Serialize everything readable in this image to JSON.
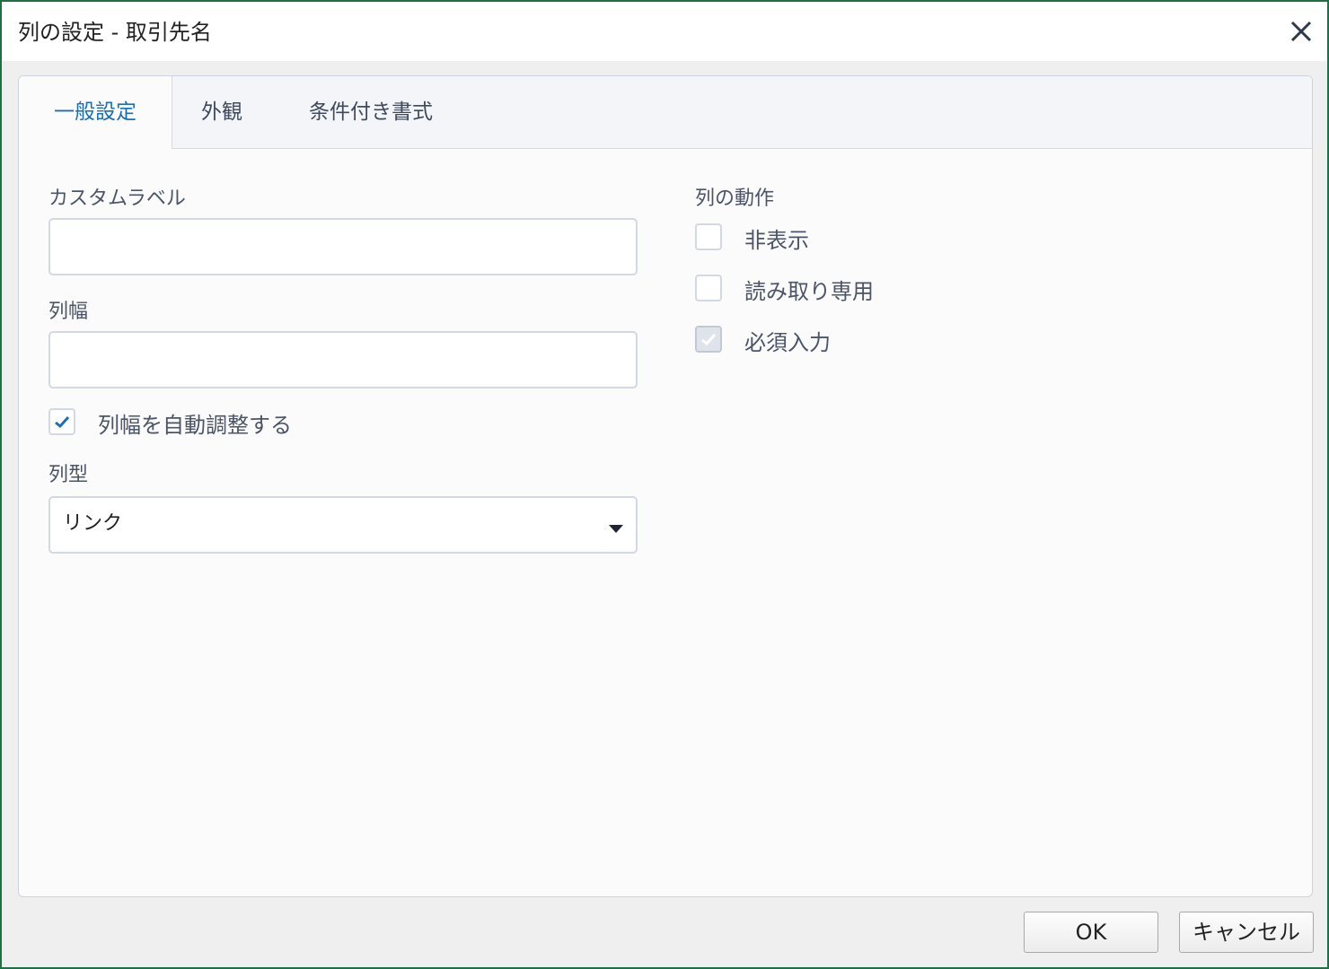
{
  "window": {
    "title": "列の設定 - 取引先名"
  },
  "tabs": [
    {
      "label": "一般設定",
      "active": true
    },
    {
      "label": "外観",
      "active": false
    },
    {
      "label": "条件付き書式",
      "active": false
    }
  ],
  "general": {
    "custom_label": {
      "label": "カスタムラベル",
      "value": "",
      "placeholder": ""
    },
    "column_width": {
      "label": "列幅",
      "value": "",
      "placeholder": ""
    },
    "autofit": {
      "label": "列幅を自動調整する",
      "checked": true
    },
    "column_type": {
      "label": "列型",
      "selected": "リンク"
    }
  },
  "behavior": {
    "heading": "列の動作",
    "options": [
      {
        "label": "非表示",
        "checked": false,
        "disabled": false
      },
      {
        "label": "読み取り専用",
        "checked": false,
        "disabled": false
      },
      {
        "label": "必須入力",
        "checked": true,
        "disabled": true
      }
    ]
  },
  "footer": {
    "ok_label": "OK",
    "cancel_label": "キャンセル"
  },
  "colors": {
    "frame": "#1e7145",
    "accent": "#1a6fb5",
    "check": "#1a6fb5"
  },
  "icons": {
    "close": "close-icon",
    "dropdown": "chevron-down-icon",
    "check": "check-icon"
  }
}
